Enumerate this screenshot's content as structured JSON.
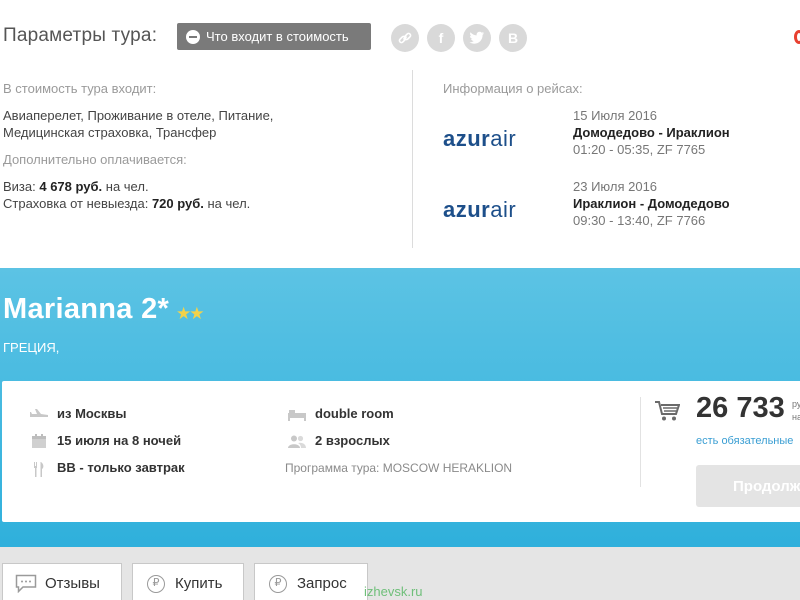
{
  "header": {
    "title": "Параметры тура:",
    "included_button": "Что входит в стоимость",
    "social": [
      {
        "icon": "link-icon",
        "glyph": "⛓"
      },
      {
        "icon": "facebook-icon",
        "glyph": "f"
      },
      {
        "icon": "twitter-icon",
        "glyph": "t"
      },
      {
        "icon": "vk-icon",
        "glyph": "B"
      }
    ]
  },
  "included": {
    "label": "В стоимость тура входит:",
    "line1": "Авиаперелет, Проживание в отеле, Питание,",
    "line2": "Медицинская страховка, Трансфер",
    "extra_label": "Дополнительно оплачивается:",
    "visa_prefix": "Виза: ",
    "visa_amount": "4 678 руб.",
    "visa_suffix": " на чел.",
    "insurance_prefix": "Страховка от невыезда: ",
    "insurance_amount": "720 руб.",
    "insurance_suffix": " на чел."
  },
  "flights": {
    "label": "Информация о рейсах:",
    "items": [
      {
        "airline_bold": "azur",
        "airline_light": "air",
        "date": "15 Июля 2016",
        "route": "Домодедово - Ираклион",
        "time": "01:20 - 05:35, ZF 7765"
      },
      {
        "airline_bold": "azur",
        "airline_light": "air",
        "date": "23 Июля 2016",
        "route": "Ираклион - Домодедово",
        "time": "09:30 - 13:40, ZF 7766"
      }
    ]
  },
  "hotel": {
    "name": "Marianna 2*",
    "stars": "★★",
    "country": "ГРЕЦИЯ,",
    "departure": "из Москвы",
    "dates": "15 июля на 8 ночей",
    "meal": "BB - только завтрак",
    "room": "double room",
    "guests": "2 взрослых",
    "program": "Программа тура: MOSCOW HERAKLION",
    "price": "26 733",
    "currency_line1": "ру",
    "currency_line2": "на",
    "obligatory": "есть обязательные",
    "continue": "Продолж"
  },
  "tabs": {
    "reviews": "Отзывы",
    "buy": "Купить",
    "request": "Запрос",
    "buy_icon": "₽",
    "request_icon": "₽"
  },
  "watermark": "izhevsk.ru",
  "colors": {
    "band": "#40b8e0",
    "button_gray": "#7a7a7a",
    "airline_blue": "#1d4f8a",
    "star_yellow": "#f3d24a",
    "link_blue": "#3a9ed3"
  }
}
